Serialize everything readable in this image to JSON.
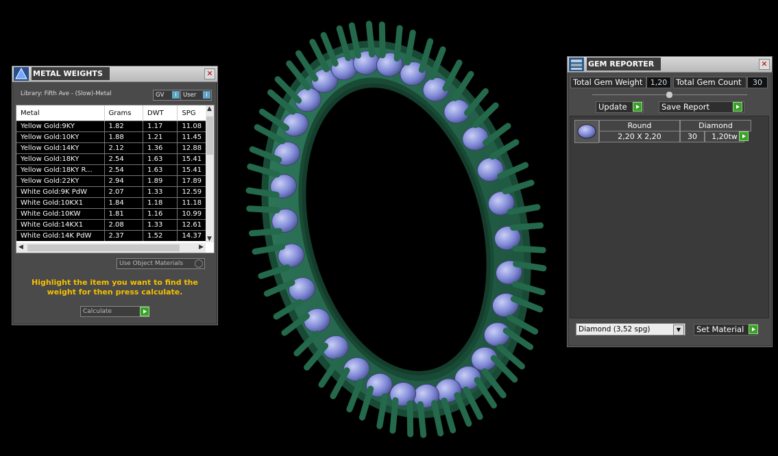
{
  "metal_weights": {
    "title": "METAL WEIGHTS",
    "close": "✕",
    "library": "Library: Fifth Ave - (Slow)-Metal",
    "toggle_gv": "GV",
    "toggle_user": "User",
    "toggle_indicator": "I",
    "columns": [
      "Metal",
      "Grams",
      "DWT",
      "SPG"
    ],
    "rows": [
      [
        "Yellow Gold:9KY",
        "1.82",
        "1.17",
        "11.08"
      ],
      [
        "Yellow Gold:10KY",
        "1.88",
        "1.21",
        "11.45"
      ],
      [
        "Yellow Gold:14KY",
        "2.12",
        "1.36",
        "12.88"
      ],
      [
        "Yellow Gold:18KY",
        "2.54",
        "1.63",
        "15.41"
      ],
      [
        "Yellow Gold:18KY R...",
        "2.54",
        "1.63",
        "15.41"
      ],
      [
        "Yellow Gold:22KY",
        "2.94",
        "1.89",
        "17.89"
      ],
      [
        "White Gold:9K PdW",
        "2.07",
        "1.33",
        "12.59"
      ],
      [
        "White Gold:10KX1",
        "1.84",
        "1.18",
        "11.18"
      ],
      [
        "White Gold:10KW",
        "1.81",
        "1.16",
        "10.99"
      ],
      [
        "White Gold:14KX1",
        "2.08",
        "1.33",
        "12.61"
      ],
      [
        "White Gold:14K PdW",
        "2.37",
        "1.52",
        "14.37"
      ]
    ],
    "use_object_materials": "Use Object Materials",
    "hint": "Highlight the item you want to find the weight for then press calculate.",
    "calculate_label": "Calculate"
  },
  "gem_reporter": {
    "title": "GEM REPORTER",
    "close": "✕",
    "total_weight_label": "Total Gem Weight",
    "total_weight_value": "1,20",
    "total_count_label": "Total Gem Count",
    "total_count_value": "30",
    "update_label": "Update",
    "save_report_label": "Save Report",
    "gem": {
      "shape": "Round",
      "material": "Diamond",
      "size": "2,20 X 2,20",
      "count": "30",
      "weight": "1,20tw"
    },
    "material_select": "Diamond    (3,52 spg)",
    "set_material_label": "Set Material"
  }
}
